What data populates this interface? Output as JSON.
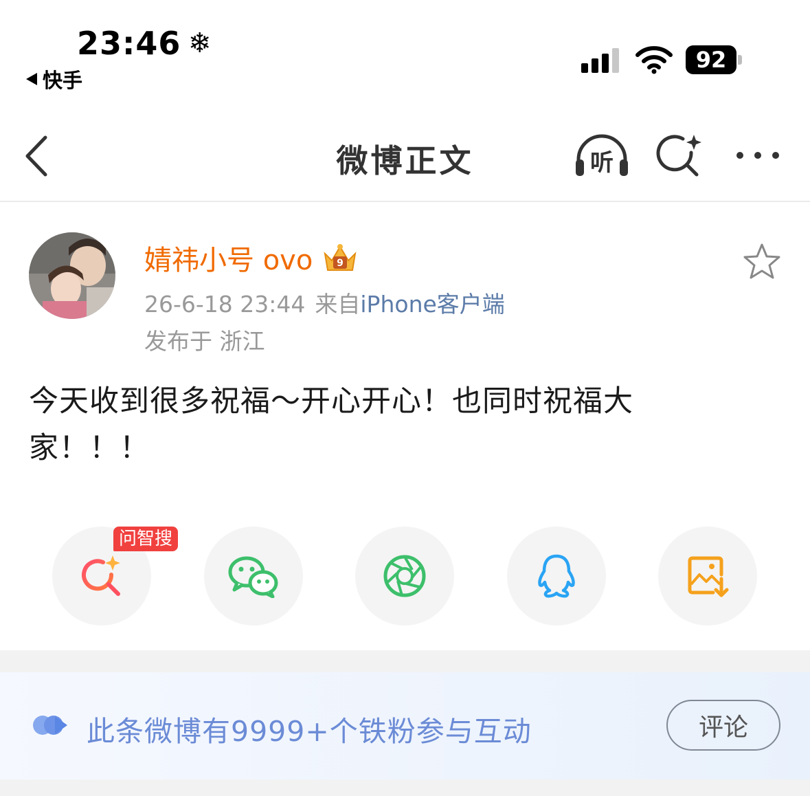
{
  "status_bar": {
    "time": "23:46",
    "snow_symbol": "❄",
    "back_app_label": "快手",
    "battery": "92"
  },
  "navbar": {
    "title": "微博正文",
    "listen_label": "听"
  },
  "post": {
    "username": "婧祎小号 ovo",
    "timestamp": "26-6-18 23:44",
    "source_prefix": "来自",
    "source": "iPhone客户端",
    "location": "发布于 浙江",
    "text": "今天收到很多祝福～开心开心！也同时祝福大家！！！"
  },
  "share": {
    "badge": "问智搜",
    "items": [
      "ai-search-icon",
      "wechat-icon",
      "moments-icon",
      "qq-icon",
      "save-image-icon"
    ]
  },
  "fans_banner": {
    "text": "此条微博有9999+个铁粉参与互动",
    "comment_button": "评论"
  },
  "colors": {
    "username": "#f06a00",
    "source": "#5b7ba8",
    "fans_text": "#6b8bd6",
    "badge": "#f0413f",
    "wechat": "#3dbf6b",
    "qq": "#2aa4f4",
    "save": "#f5a11c"
  }
}
